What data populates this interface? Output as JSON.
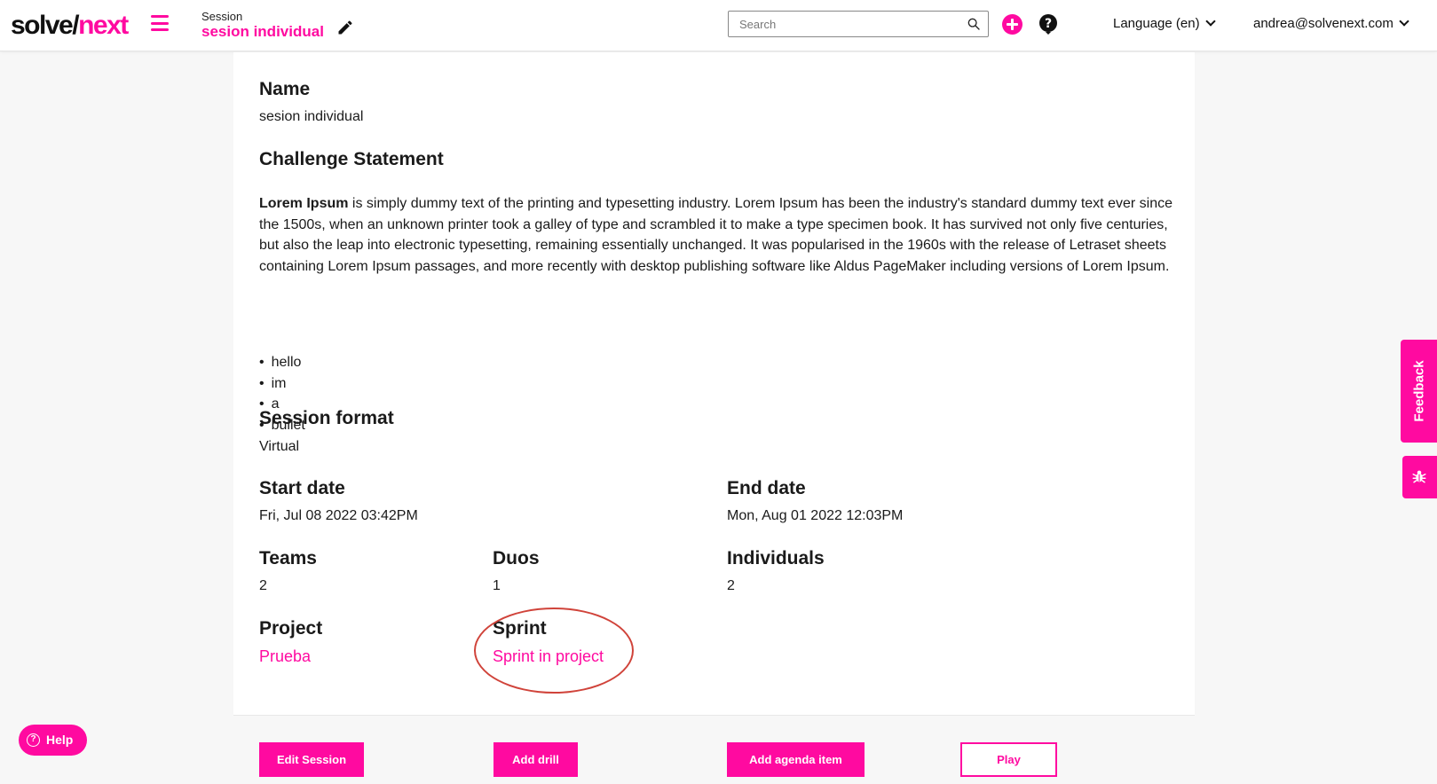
{
  "header": {
    "logo_part1": "solve/",
    "logo_part2": "next",
    "session_kicker": "Session",
    "session_name": "sesion individual",
    "search_placeholder": "Search",
    "language_label": "Language (en)",
    "user_email": "andrea@solvenext.com"
  },
  "session": {
    "name_label": "Name",
    "name_value": "sesion individual",
    "challenge_label": "Challenge Statement",
    "challenge_bold": "Lorem Ipsum",
    "challenge_text": " is simply dummy text of the printing and typesetting industry. Lorem Ipsum has been the industry's standard dummy text ever since the 1500s, when an unknown printer took a galley of type and scrambled it to make a type specimen book. It has survived not only five centuries, but also the leap into electronic typesetting, remaining essentially unchanged. It was popularised in the 1960s with the release of Letraset sheets containing Lorem Ipsum passages, and more recently with desktop publishing software like Aldus PageMaker including versions of Lorem Ipsum.",
    "bullets": [
      "hello",
      "im",
      "a",
      "bullet"
    ],
    "format_label": "Session format",
    "format_value": "Virtual",
    "start_label": "Start date",
    "start_value": "Fri, Jul 08 2022 03:42PM",
    "end_label": "End date",
    "end_value": "Mon, Aug 01 2022 12:03PM",
    "teams_label": "Teams",
    "teams_value": "2",
    "duos_label": "Duos",
    "duos_value": "1",
    "individuals_label": "Individuals",
    "individuals_value": "2",
    "project_label": "Project",
    "project_value": "Prueba",
    "sprint_label": "Sprint",
    "sprint_value": "Sprint in project"
  },
  "actions": {
    "edit_session": "Edit Session",
    "add_drill": "Add drill",
    "add_agenda_item": "Add agenda item",
    "play": "Play"
  },
  "widgets": {
    "feedback": "Feedback",
    "help": "Help"
  },
  "colors": {
    "accent": "#ff0aa0",
    "highlight_circle": "#d0433a"
  }
}
